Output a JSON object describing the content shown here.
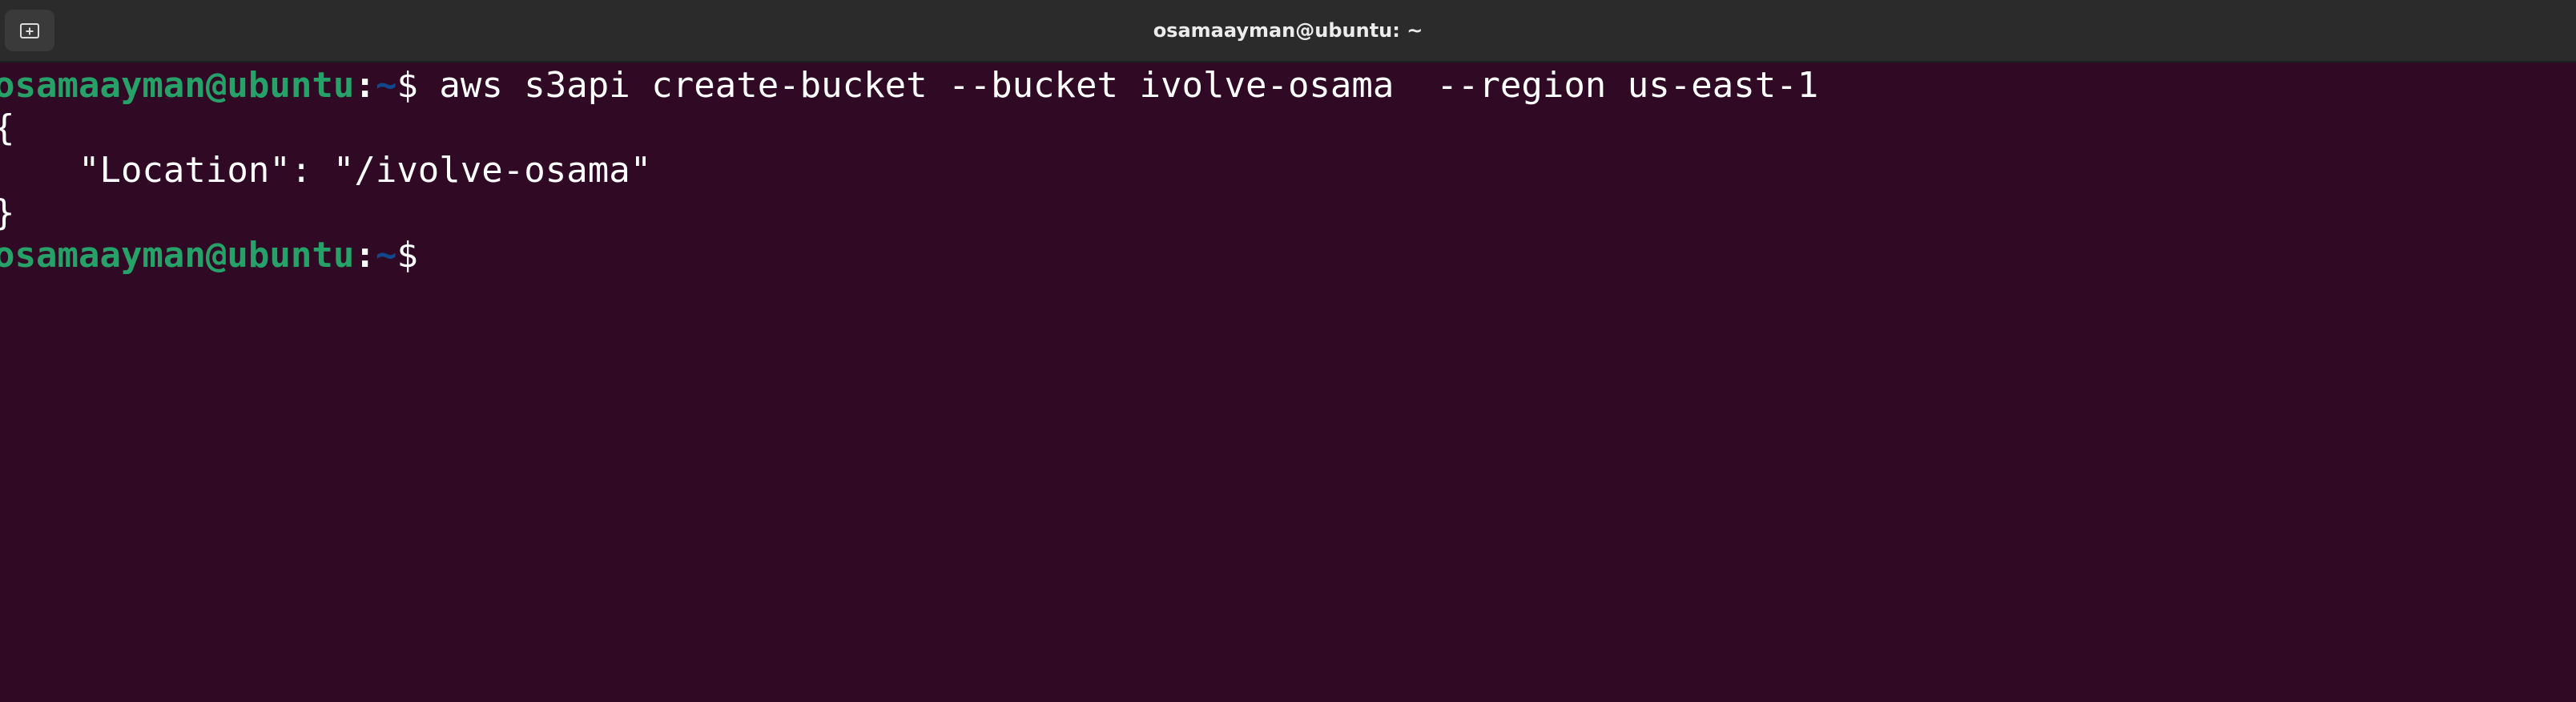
{
  "window": {
    "title": "osamaayman@ubuntu: ~"
  },
  "titlebar": {
    "new_tab_icon": "new-tab-icon"
  },
  "colors": {
    "terminal_bg": "#300a24",
    "titlebar_bg": "#2b2b2b",
    "prompt_user": "#26a269",
    "prompt_path": "#12488b",
    "text": "#ffffff"
  },
  "terminal": {
    "prompt_user_host": "osamaayman@ubuntu",
    "prompt_colon": ":",
    "prompt_path": "~",
    "prompt_symbol": "$",
    "command": " aws s3api create-bucket --bucket ivolve-osama  --region us-east-1",
    "output": [
      "{",
      "    \"Location\": \"/ivolve-osama\"",
      "}"
    ]
  }
}
